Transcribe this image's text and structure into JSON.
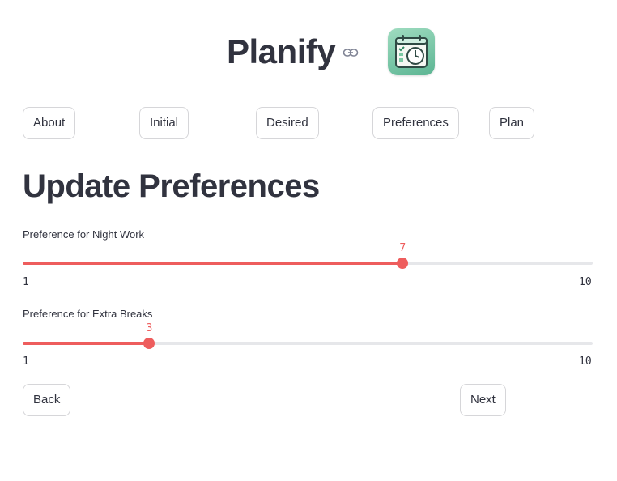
{
  "app": {
    "title": "Planify",
    "logo": "calendar-clock-icon"
  },
  "nav": {
    "about": "About",
    "initial": "Initial",
    "desired": "Desired",
    "preferences": "Preferences",
    "plan": "Plan"
  },
  "page": {
    "heading": "Update Preferences"
  },
  "sliders": {
    "night_work": {
      "label": "Preference for Night Work",
      "value": "7",
      "min": "1",
      "max": "10"
    },
    "extra_breaks": {
      "label": "Preference for Extra Breaks",
      "value": "3",
      "min": "1",
      "max": "10"
    }
  },
  "footer": {
    "back": "Back",
    "next": "Next"
  },
  "colors": {
    "accent": "#ee5d5d",
    "text": "#31333f",
    "track": "#e6e7ea",
    "border": "#d6d6d9"
  }
}
